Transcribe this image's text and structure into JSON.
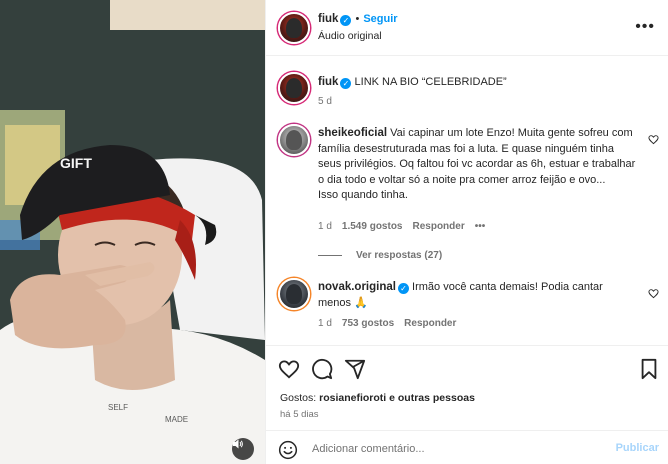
{
  "post": {
    "author": "fiuk",
    "follow_label": "Seguir",
    "audio": "Áudio original",
    "separator": "•"
  },
  "caption": {
    "username": "fiuk",
    "text": "LINK NA BIO “CELEBRIDADE”",
    "time": "5 d"
  },
  "comments": [
    {
      "username": "sheikeoficial",
      "text": "Vai capinar um lote Enzo! Muita gente sofreu com família desestruturada mas foi a luta. E quase ninguém tinha seus privilégios. Oq faltou foi vc acordar as 6h, estuar e trabalhar o dia todo e voltar só a noite pra comer arroz feijão e ovo...",
      "text2": "Isso quando tinha.",
      "time": "1 d",
      "likes": "1.549 gostos",
      "reply": "Responder",
      "more": "•••",
      "view_replies": "Ver respostas (27)"
    },
    {
      "username": "novak.original",
      "text": "Irmão você canta demais! Podia cantar menos 🙏",
      "time": "1 d",
      "likes": "753 gostos",
      "reply": "Responder"
    }
  ],
  "likes_line": {
    "prefix": "Gostos:",
    "user": "rosianefioroti",
    "suffix": "e outras pessoas"
  },
  "post_date": "há 5 dias",
  "add_comment": {
    "placeholder": "Adicionar comentário...",
    "publish_label": "Publicar"
  },
  "icons": {
    "heart": "heart-icon",
    "comment": "comment-icon",
    "share": "share-icon",
    "save": "bookmark-icon",
    "emoji": "emoji-icon",
    "more": "more-icon",
    "mute": "speaker-icon"
  },
  "colors": {
    "accent": "#0095f6",
    "muted": "#737373",
    "publish_disabled": "#a8d5fb"
  },
  "media": {
    "cap_text": "GIFT",
    "tattoo1": "SELF",
    "tattoo2": "MADE"
  }
}
